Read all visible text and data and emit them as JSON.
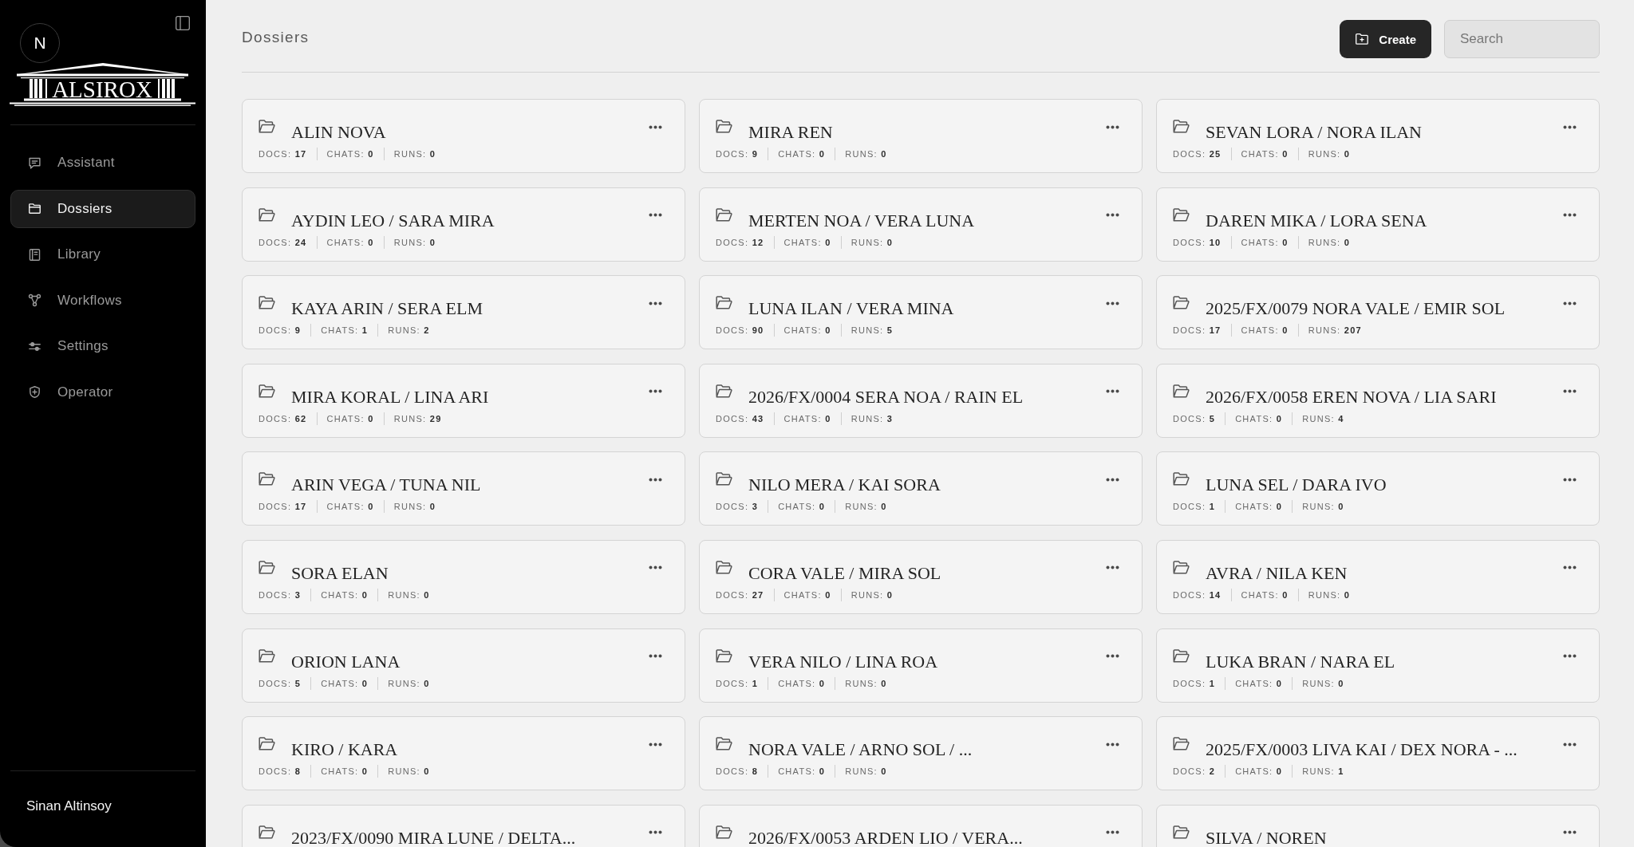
{
  "sidebar": {
    "avatar_initial": "N",
    "logo_text": "ALSIROX",
    "nav_items": [
      {
        "label": "Assistant",
        "kind": "chat",
        "selected": false
      },
      {
        "label": "Dossiers",
        "kind": "folder",
        "selected": true
      },
      {
        "label": "Library",
        "kind": "book",
        "selected": false
      },
      {
        "label": "Workflows",
        "kind": "workflow",
        "selected": false
      },
      {
        "label": "Settings",
        "kind": "sliders",
        "selected": false
      },
      {
        "label": "Operator",
        "kind": "shield",
        "selected": false
      }
    ],
    "user_name": "Sinan Altinsoy"
  },
  "header": {
    "title": "Dossiers",
    "create_button": "Create",
    "search": {
      "placeholder": "Search"
    }
  },
  "dossiers": [
    {
      "name": "ALIN NOVA",
      "stats": [
        {
          "label": "DOCS:",
          "value": "17"
        },
        {
          "label": "CHATS:",
          "value": "0"
        },
        {
          "label": "RUNS:",
          "value": "0"
        }
      ]
    },
    {
      "name": "MIRA REN",
      "stats": [
        {
          "label": "DOCS:",
          "value": "9"
        },
        {
          "label": "CHATS:",
          "value": "0"
        },
        {
          "label": "RUNS:",
          "value": "0"
        }
      ]
    },
    {
      "name": "SEVAN LORA / NORA ILAN",
      "stats": [
        {
          "label": "DOCS:",
          "value": "25"
        },
        {
          "label": "CHATS:",
          "value": "0"
        },
        {
          "label": "RUNS:",
          "value": "0"
        }
      ]
    },
    {
      "name": "AYDIN LEO / SARA MIRA",
      "stats": [
        {
          "label": "DOCS:",
          "value": "24"
        },
        {
          "label": "CHATS:",
          "value": "0"
        },
        {
          "label": "RUNS:",
          "value": "0"
        }
      ]
    },
    {
      "name": "MERTEN NOA / VERA LUNA",
      "stats": [
        {
          "label": "DOCS:",
          "value": "12"
        },
        {
          "label": "CHATS:",
          "value": "0"
        },
        {
          "label": "RUNS:",
          "value": "0"
        }
      ]
    },
    {
      "name": "DAREN MIKA / LORA SENA",
      "stats": [
        {
          "label": "DOCS:",
          "value": "10"
        },
        {
          "label": "CHATS:",
          "value": "0"
        },
        {
          "label": "RUNS:",
          "value": "0"
        }
      ]
    },
    {
      "name": "KAYA ARIN / SERA ELM",
      "stats": [
        {
          "label": "DOCS:",
          "value": "9"
        },
        {
          "label": "CHATS:",
          "value": "1"
        },
        {
          "label": "RUNS:",
          "value": "2"
        }
      ]
    },
    {
      "name": "LUNA ILAN / VERA MINA",
      "stats": [
        {
          "label": "DOCS:",
          "value": "90"
        },
        {
          "label": "CHATS:",
          "value": "0"
        },
        {
          "label": "RUNS:",
          "value": "5"
        }
      ]
    },
    {
      "name": "2025/FX/0079 NORA VALE / EMIR SOL",
      "stats": [
        {
          "label": "DOCS:",
          "value": "17"
        },
        {
          "label": "CHATS:",
          "value": "0"
        },
        {
          "label": "RUNS:",
          "value": "207"
        }
      ]
    },
    {
      "name": "MIRA KORAL / LINA ARI",
      "stats": [
        {
          "label": "DOCS:",
          "value": "62"
        },
        {
          "label": "CHATS:",
          "value": "0"
        },
        {
          "label": "RUNS:",
          "value": "29"
        }
      ]
    },
    {
      "name": "2026/FX/0004 SERA NOA / RAIN EL",
      "stats": [
        {
          "label": "DOCS:",
          "value": "43"
        },
        {
          "label": "CHATS:",
          "value": "0"
        },
        {
          "label": "RUNS:",
          "value": "3"
        }
      ]
    },
    {
      "name": "2026/FX/0058 EREN NOVA / LIA SARI",
      "stats": [
        {
          "label": "DOCS:",
          "value": "5"
        },
        {
          "label": "CHATS:",
          "value": "0"
        },
        {
          "label": "RUNS:",
          "value": "4"
        }
      ]
    },
    {
      "name": "ARIN VEGA / TUNA NIL",
      "stats": [
        {
          "label": "DOCS:",
          "value": "17"
        },
        {
          "label": "CHATS:",
          "value": "0"
        },
        {
          "label": "RUNS:",
          "value": "0"
        }
      ]
    },
    {
      "name": "NILO MERA / KAI SORA",
      "stats": [
        {
          "label": "DOCS:",
          "value": "3"
        },
        {
          "label": "CHATS:",
          "value": "0"
        },
        {
          "label": "RUNS:",
          "value": "0"
        }
      ]
    },
    {
      "name": "LUNA SEL / DARA IVO",
      "stats": [
        {
          "label": "DOCS:",
          "value": "1"
        },
        {
          "label": "CHATS:",
          "value": "0"
        },
        {
          "label": "RUNS:",
          "value": "0"
        }
      ]
    },
    {
      "name": "SORA ELAN",
      "stats": [
        {
          "label": "DOCS:",
          "value": "3"
        },
        {
          "label": "CHATS:",
          "value": "0"
        },
        {
          "label": "RUNS:",
          "value": "0"
        }
      ]
    },
    {
      "name": "CORA VALE / MIRA SOL",
      "stats": [
        {
          "label": "DOCS:",
          "value": "27"
        },
        {
          "label": "CHATS:",
          "value": "0"
        },
        {
          "label": "RUNS:",
          "value": "0"
        }
      ]
    },
    {
      "name": "AVRA / NILA KEN",
      "stats": [
        {
          "label": "DOCS:",
          "value": "14"
        },
        {
          "label": "CHATS:",
          "value": "0"
        },
        {
          "label": "RUNS:",
          "value": "0"
        }
      ]
    },
    {
      "name": "ORION LANA",
      "stats": [
        {
          "label": "DOCS:",
          "value": "5"
        },
        {
          "label": "CHATS:",
          "value": "0"
        },
        {
          "label": "RUNS:",
          "value": "0"
        }
      ]
    },
    {
      "name": "VERA NILO / LINA ROA",
      "stats": [
        {
          "label": "DOCS:",
          "value": "1"
        },
        {
          "label": "CHATS:",
          "value": "0"
        },
        {
          "label": "RUNS:",
          "value": "0"
        }
      ]
    },
    {
      "name": "LUKA BRAN / NARA EL",
      "stats": [
        {
          "label": "DOCS:",
          "value": "1"
        },
        {
          "label": "CHATS:",
          "value": "0"
        },
        {
          "label": "RUNS:",
          "value": "0"
        }
      ]
    },
    {
      "name": "KIRO / KARA",
      "stats": [
        {
          "label": "DOCS:",
          "value": "8"
        },
        {
          "label": "CHATS:",
          "value": "0"
        },
        {
          "label": "RUNS:",
          "value": "0"
        }
      ]
    },
    {
      "name": "NORA VALE / ARNO SOL / ...",
      "stats": [
        {
          "label": "DOCS:",
          "value": "8"
        },
        {
          "label": "CHATS:",
          "value": "0"
        },
        {
          "label": "RUNS:",
          "value": "0"
        }
      ]
    },
    {
      "name": "2025/FX/0003 LIVA KAI / DEX NORA - ...",
      "stats": [
        {
          "label": "DOCS:",
          "value": "2"
        },
        {
          "label": "CHATS:",
          "value": "0"
        },
        {
          "label": "RUNS:",
          "value": "1"
        }
      ]
    },
    {
      "name": "2023/FX/0090 MIRA LUNE / DELTA..."
    },
    {
      "name": "2026/FX/0053 ARDEN LIO / VERA..."
    },
    {
      "name": "SILVA / NOREN"
    }
  ]
}
